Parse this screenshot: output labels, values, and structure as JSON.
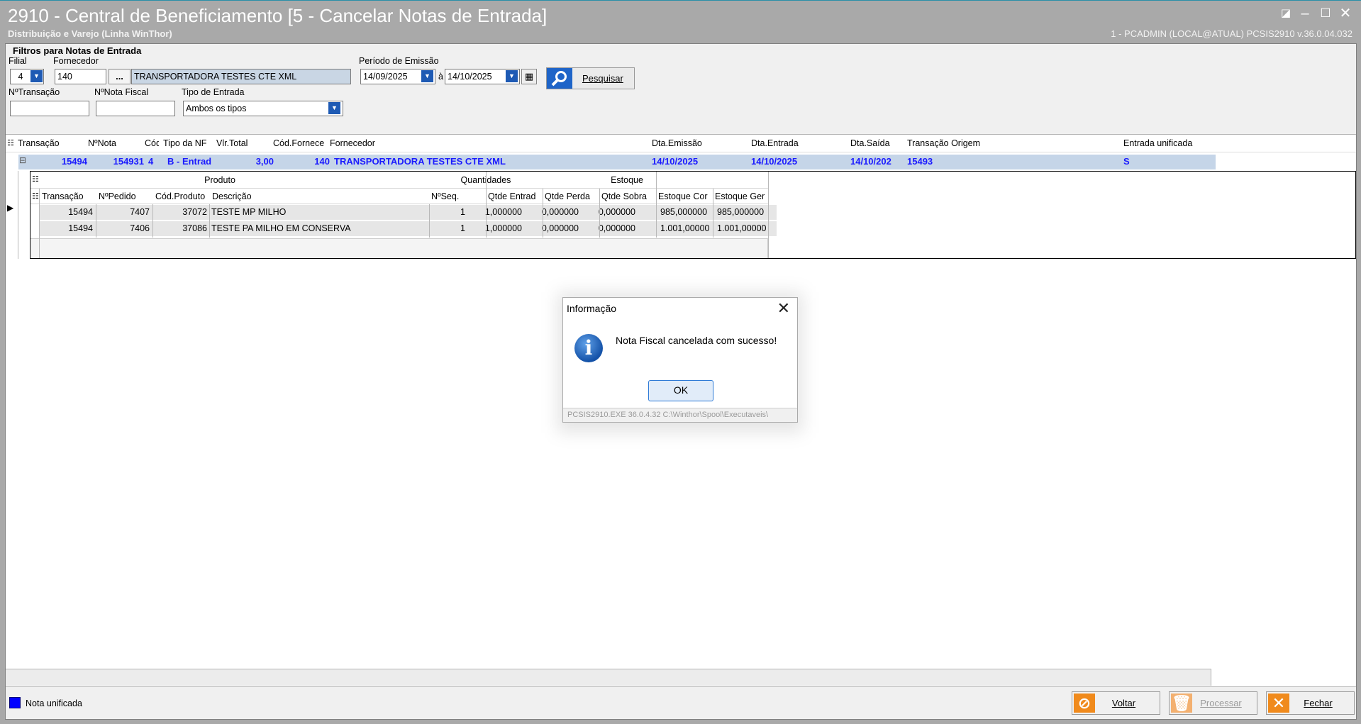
{
  "window": {
    "title": "2910 - Central de Beneficiamento [5 - Cancelar Notas de Entrada]",
    "subtitle": "Distribuição e Varejo (Linha WinThor)",
    "user_info": "1 - PCADMIN (LOCAL@ATUAL)   PCSIS2910  v.36.0.04.032"
  },
  "filters": {
    "group_title": "Filtros para Notas de Entrada",
    "filial_label": "Filial",
    "filial_value": "4",
    "fornecedor_label": "Fornecedor",
    "fornecedor_code": "140",
    "fornecedor_lookup": "...",
    "fornecedor_name": "TRANSPORTADORA TESTES CTE XML",
    "periodo_label": "Período de Emissão",
    "date_from": "14/09/2025",
    "date_sep": "à",
    "date_to": "14/10/2025",
    "search_label": "Pesquisar",
    "ntransacao_label": "NºTransação",
    "nnota_label": "NºNota Fiscal",
    "tipo_entrada_label": "Tipo de Entrada",
    "tipo_entrada_value": "Ambos os tipos"
  },
  "grid": {
    "headers": [
      "Transação",
      "NºNota",
      "Cód",
      "Tipo da NF",
      "Vlr.Total",
      "Cód.Fornece",
      "Fornecedor",
      "Dta.Emissão",
      "Dta.Entrada",
      "Dta.Saída",
      "Transação Origem",
      "Entrada unificada"
    ],
    "row": {
      "expand": "⊟",
      "transacao": "15494",
      "nnota": "154931",
      "cod": "4",
      "tipo_nf": "B - Entrad",
      "vlr_total": "3,00",
      "cod_fornec": "140",
      "fornecedor": "TRANSPORTADORA TESTES CTE XML",
      "dta_emissao": "14/10/2025",
      "dta_entrada": "14/10/2025",
      "dta_saida": "14/10/202",
      "transacao_origem": "15493",
      "entrada_unificada": "S"
    },
    "detail": {
      "band_produto": "Produto",
      "band_quantidades": "Quantidades",
      "band_estoque": "Estoque",
      "headers": [
        "Transação",
        "NºPedido",
        "Cód.Produto",
        "Descrição",
        "NºSeq.",
        "Qtde Entrad",
        "Qtde Perda",
        "Qtde Sobra",
        "Estoque Cor",
        "Estoque Ger"
      ],
      "rows": [
        {
          "transacao": "15494",
          "npedido": "7407",
          "cod_produto": "37072",
          "descricao": "TESTE MP MILHO",
          "nseq": "1",
          "qtde_entrada": "1,000000",
          "qtde_perda": "0,000000",
          "qtde_sobra": "0,000000",
          "estoque_cor": "985,000000",
          "estoque_ger": "985,000000"
        },
        {
          "transacao": "15494",
          "npedido": "7406",
          "cod_produto": "37086",
          "descricao": "TESTE PA MILHO EM CONSERVA",
          "nseq": "1",
          "qtde_entrada": "1,000000",
          "qtde_perda": "0,000000",
          "qtde_sobra": "0,000000",
          "estoque_cor": "1.001,00000",
          "estoque_ger": "1.001,00000"
        }
      ]
    }
  },
  "legend": {
    "label": "Nota unificada",
    "color": "#0000ff"
  },
  "actions": {
    "voltar": "Voltar",
    "processar": "Processar",
    "fechar": "Fechar"
  },
  "dialog": {
    "title": "Informação",
    "message": "Nota Fiscal cancelada com sucesso!",
    "ok_label": "OK",
    "footer": "PCSIS2910.EXE 36.0.4.32 C:\\Winthor\\Spool\\Executaveis\\"
  },
  "icons": [
    "restore-icon",
    "minimize-icon",
    "maximize-icon",
    "close-icon",
    "dropdown-arrow-icon",
    "calendar-icon",
    "search-icon",
    "info-icon",
    "cancel-icon",
    "trash-icon",
    "x-icon",
    "expand-icon",
    "row-indicator-icon"
  ]
}
